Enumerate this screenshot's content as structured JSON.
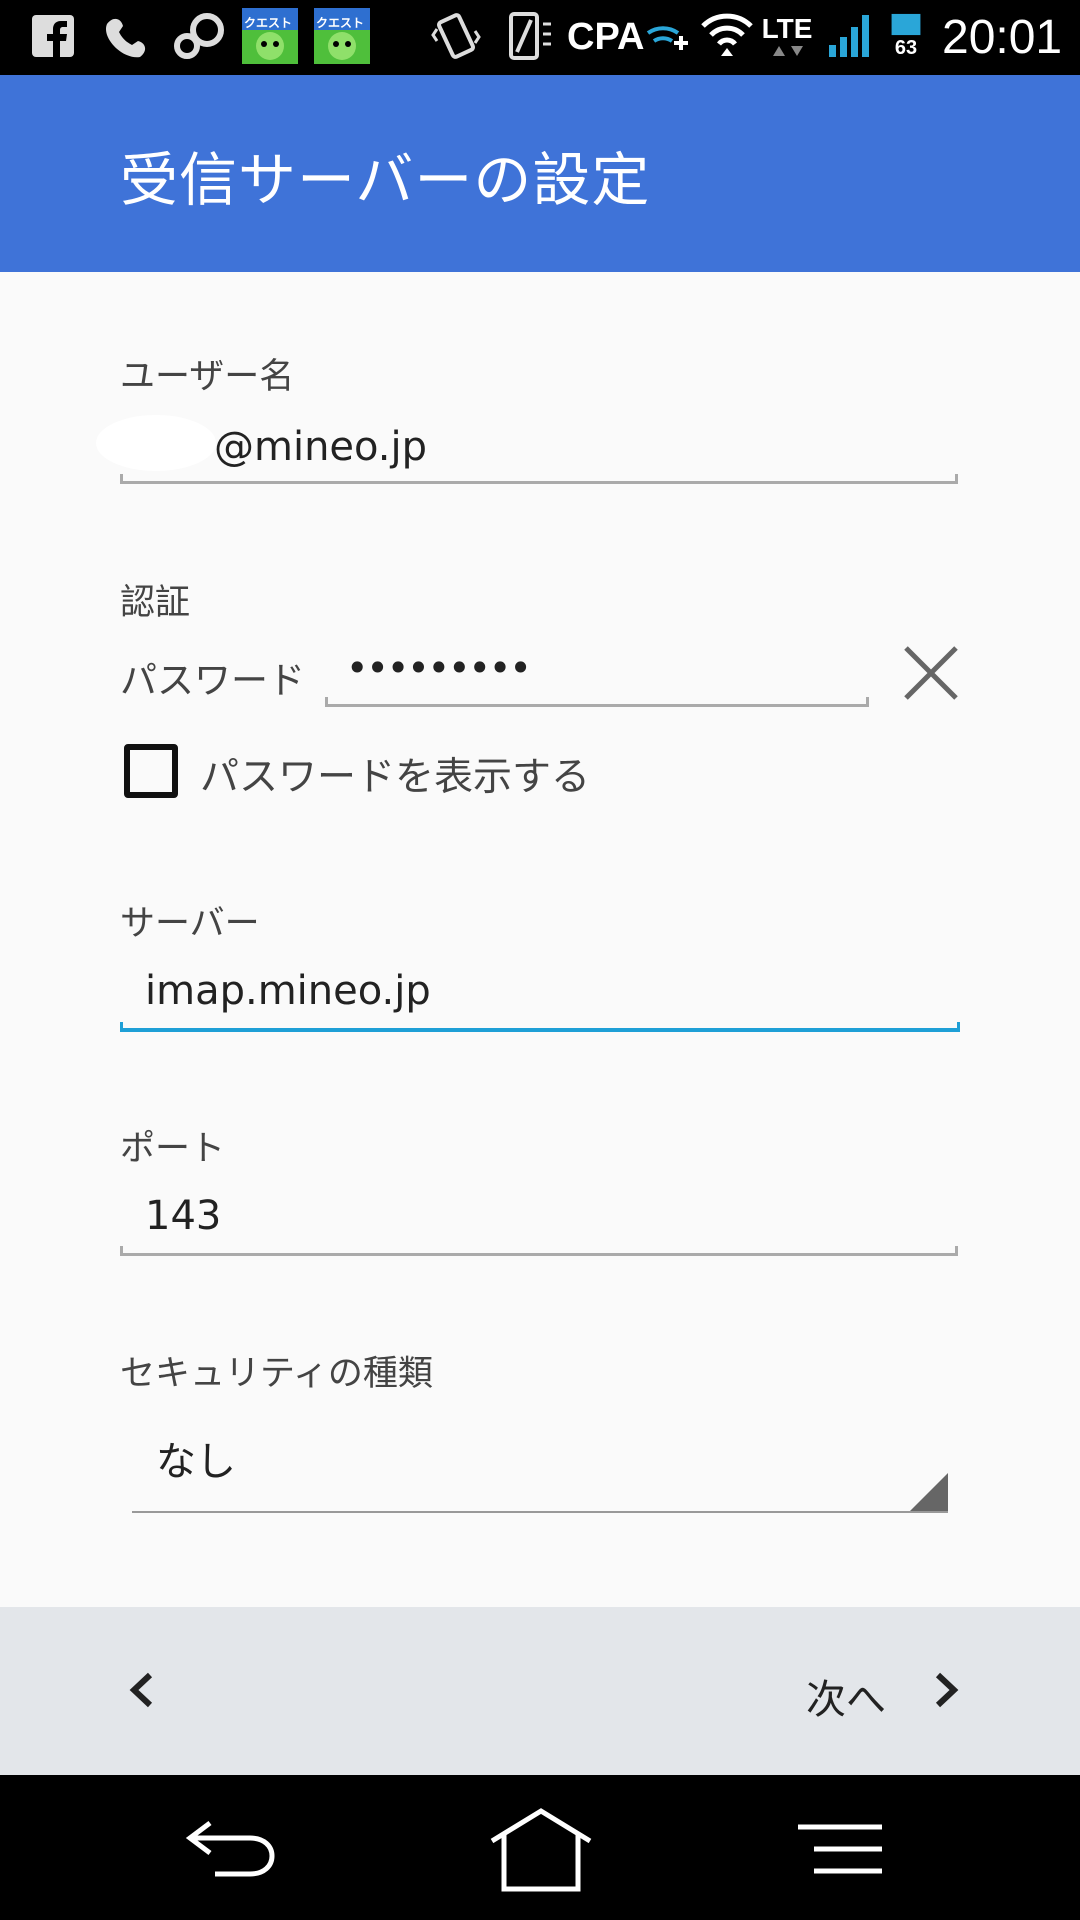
{
  "status_bar": {
    "network_label": "CPA",
    "lte_label": "LTE",
    "battery_level": "63",
    "time": "20:01",
    "icons": [
      "facebook-icon",
      "phone-icon",
      "chat-icon",
      "quest-app-icon",
      "quest-app-icon",
      "vibrate-icon",
      "screen-icon",
      "cpa-icon",
      "wifi-plus-icon",
      "wifi-icon",
      "lte-icon",
      "signal-icon",
      "battery-icon"
    ],
    "quest_label": "クエスト"
  },
  "appbar": {
    "title": "受信サーバーの設定",
    "color": "#3f73d8"
  },
  "form": {
    "username": {
      "label": "ユーザー名",
      "value": "@mineo.jp"
    },
    "auth": {
      "label": "認証",
      "password_label": "パスワード",
      "password_value": "•••••••••",
      "show_password_label": "パスワードを表示する",
      "show_password_checked": false
    },
    "server": {
      "label": "サーバー",
      "value": "imap.mineo.jp",
      "focus_color": "#1e9fd6"
    },
    "port": {
      "label": "ポート",
      "value": "143"
    },
    "security": {
      "label": "セキュリティの種類",
      "value": "なし"
    }
  },
  "wizard": {
    "next_label": "次へ"
  }
}
